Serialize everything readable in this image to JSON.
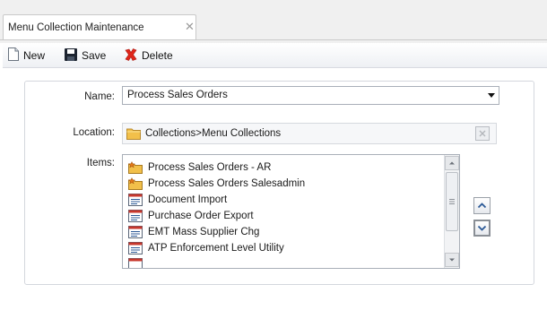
{
  "tab": {
    "title": "Menu Collection Maintenance",
    "close_glyph": "✕"
  },
  "toolbar": {
    "new_label": "New",
    "save_label": "Save",
    "delete_label": "Delete"
  },
  "form": {
    "name_label": "Name:",
    "name_value": "Process Sales Orders",
    "location_label": "Location:",
    "location_value": "Collections>Menu Collections",
    "items_label": "Items:"
  },
  "items": [
    {
      "label": "Process Sales Orders - AR",
      "icon": "folder-star-icon"
    },
    {
      "label": "Process Sales Orders Salesadmin",
      "icon": "folder-star-icon"
    },
    {
      "label": "Document Import",
      "icon": "program-form-icon"
    },
    {
      "label": "Purchase Order Export",
      "icon": "program-form-icon"
    },
    {
      "label": "EMT Mass Supplier Chg",
      "icon": "program-form-icon"
    },
    {
      "label": "ATP Enforcement Level Utility",
      "icon": "program-form-icon"
    }
  ],
  "colors": {
    "delete_red": "#e0261b",
    "folder_yellow": "#f2c04a",
    "accent_blue": "#2c5a97"
  }
}
